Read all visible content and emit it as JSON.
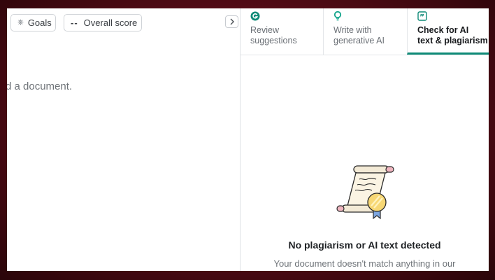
{
  "editor": {
    "goals_label": "Goals",
    "score_dash": "--",
    "score_label": "Overall score",
    "body_text": "d a document."
  },
  "panel": {
    "tabs": [
      {
        "label": "Review\nsuggestions",
        "icon": "grammarly-g-icon"
      },
      {
        "label": "Write with\ngenerative AI",
        "icon": "lightbulb-pin-icon"
      },
      {
        "label": "Check for AI\ntext & plagiarism",
        "icon": "quote-icon",
        "active": true
      }
    ],
    "empty_title": "No plagiarism or AI text detected",
    "empty_subtitle": "Your document doesn't match anything in our"
  },
  "colors": {
    "accent": "#0e8a77",
    "background": "#8a1224"
  }
}
